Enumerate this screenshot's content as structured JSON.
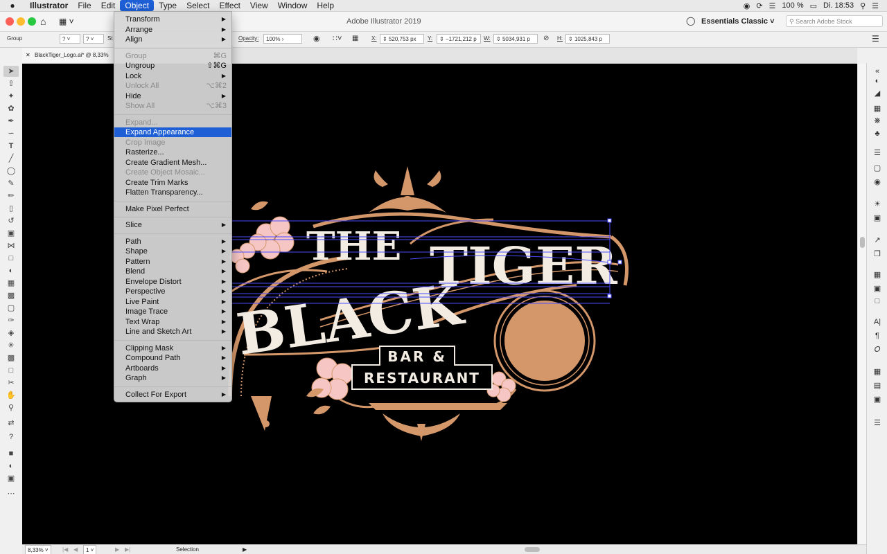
{
  "menubar": {
    "apple": "",
    "app": "Illustrator",
    "items": [
      "File",
      "Edit",
      "Object",
      "Type",
      "Select",
      "Effect",
      "View",
      "Window",
      "Help"
    ],
    "active": "Object",
    "battery": "100 %",
    "clock": "Di. 18:53"
  },
  "titlebar": {
    "title": "Adobe Illustrator 2019",
    "workspace": "Essentials Classic",
    "stock_placeholder": "Search Adobe Stock"
  },
  "controlbar": {
    "selection": "Group",
    "style_abbr": "St",
    "opacity_label": "Opacity:",
    "opacity": "100%",
    "x_label": "X:",
    "x": "520,753 px",
    "y_label": "Y:",
    "y": "−1721,212 p",
    "w_label": "W:",
    "w": "5034,931 p",
    "h_label": "H:",
    "h": "1025,843 p"
  },
  "document": {
    "tab": "BlackTiger_Logo.ai* @ 8,33%"
  },
  "artwork": {
    "line1": "THE",
    "line2a": "BLACK",
    "line2b": "TIGER",
    "line3": "BAR &",
    "line4": "RESTAURANT",
    "colors": {
      "gold": "#d4976a",
      "cream": "#f3ece3",
      "pink": "#f6c6c4",
      "bg": "#000000",
      "selection": "#4a4cff"
    }
  },
  "statusbar": {
    "zoom": "8,33%",
    "artboard": "1",
    "tool": "Selection"
  },
  "object_menu": [
    {
      "label": "Transform",
      "submenu": true
    },
    {
      "label": "Arrange",
      "submenu": true
    },
    {
      "label": "Align",
      "submenu": true
    },
    {
      "sep": true
    },
    {
      "label": "Group",
      "shortcut": "⌘G",
      "disabled": true
    },
    {
      "label": "Ungroup",
      "shortcut": "⇧⌘G"
    },
    {
      "label": "Lock",
      "submenu": true
    },
    {
      "label": "Unlock All",
      "shortcut": "⌥⌘2",
      "disabled": true
    },
    {
      "label": "Hide",
      "submenu": true
    },
    {
      "label": "Show All",
      "shortcut": "⌥⌘3",
      "disabled": true
    },
    {
      "sep": true
    },
    {
      "label": "Expand...",
      "disabled": true
    },
    {
      "label": "Expand Appearance",
      "highlighted": true
    },
    {
      "label": "Crop Image",
      "disabled": true
    },
    {
      "label": "Rasterize..."
    },
    {
      "label": "Create Gradient Mesh..."
    },
    {
      "label": "Create Object Mosaic...",
      "disabled": true
    },
    {
      "label": "Create Trim Marks"
    },
    {
      "label": "Flatten Transparency..."
    },
    {
      "sep": true
    },
    {
      "label": "Make Pixel Perfect"
    },
    {
      "sep": true
    },
    {
      "label": "Slice",
      "submenu": true
    },
    {
      "sep": true
    },
    {
      "label": "Path",
      "submenu": true
    },
    {
      "label": "Shape",
      "submenu": true
    },
    {
      "label": "Pattern",
      "submenu": true
    },
    {
      "label": "Blend",
      "submenu": true
    },
    {
      "label": "Envelope Distort",
      "submenu": true
    },
    {
      "label": "Perspective",
      "submenu": true
    },
    {
      "label": "Live Paint",
      "submenu": true
    },
    {
      "label": "Image Trace",
      "submenu": true
    },
    {
      "label": "Text Wrap",
      "submenu": true
    },
    {
      "label": "Line and Sketch Art",
      "submenu": true
    },
    {
      "sep": true
    },
    {
      "label": "Clipping Mask",
      "submenu": true
    },
    {
      "label": "Compound Path",
      "submenu": true
    },
    {
      "label": "Artboards",
      "submenu": true
    },
    {
      "label": "Graph",
      "submenu": true
    },
    {
      "sep": true
    },
    {
      "label": "Collect For Export",
      "submenu": true
    }
  ]
}
